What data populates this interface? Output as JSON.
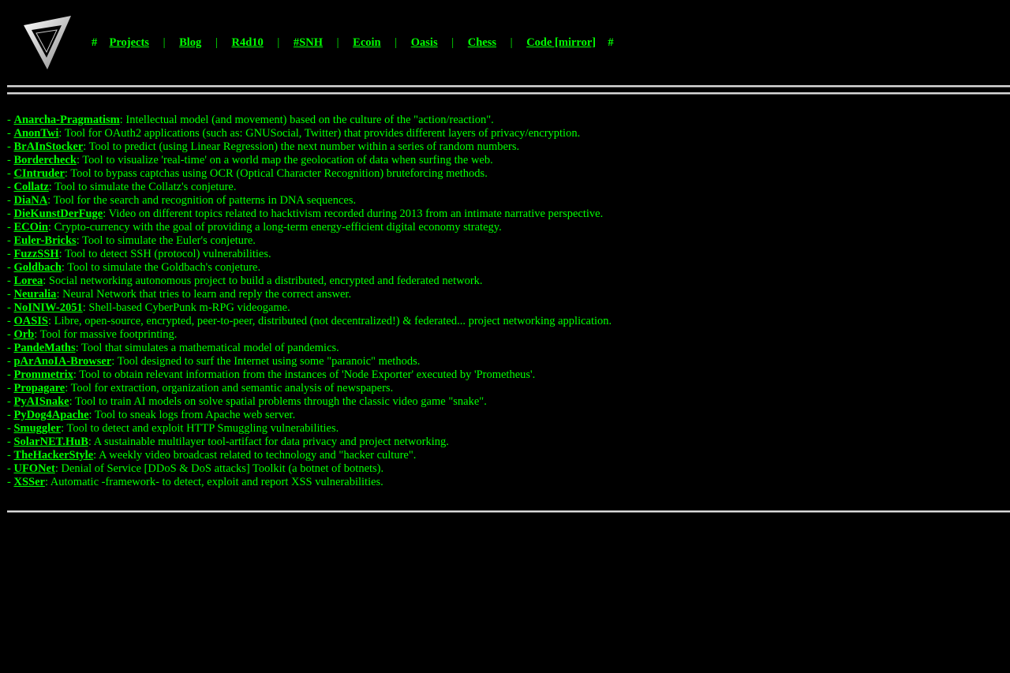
{
  "logo": {
    "icon": "triangle-logo-icon"
  },
  "nav": {
    "hash_left": "#",
    "hash_right": "#",
    "separator": "|",
    "items": [
      {
        "label": "Projects"
      },
      {
        "label": "Blog"
      },
      {
        "label": "R4d10"
      },
      {
        "label": "#SNH"
      },
      {
        "label": "Ecoin"
      },
      {
        "label": "Oasis"
      },
      {
        "label": "Chess"
      },
      {
        "label": "Code [mirror]"
      }
    ]
  },
  "projects": {
    "bullet": "- ",
    "items": [
      {
        "name": "Anarcha-Pragmatism",
        "desc": ": Intellectual model (and movement) based on the culture of the \"action/reaction\"."
      },
      {
        "name": "AnonTwi",
        "desc": ": Tool for OAuth2 applications (such as: GNUSocial, Twitter) that provides different layers of privacy/encryption."
      },
      {
        "name": "BrAInStocker",
        "desc": ": Tool to predict (using Linear Regression) the next number within a series of random numbers."
      },
      {
        "name": "Bordercheck",
        "desc": ": Tool to visualize 'real-time' on a world map the geolocation of data when surfing the web."
      },
      {
        "name": "CIntruder",
        "desc": ": Tool to bypass captchas using OCR (Optical Character Recognition) bruteforcing methods."
      },
      {
        "name": "Collatz",
        "desc": ": Tool to simulate the Collatz's conjeture."
      },
      {
        "name": "DiaNA",
        "desc": ": Tool for the search and recognition of patterns in DNA sequences."
      },
      {
        "name": "DieKunstDerFuge",
        "desc": ": Video on different topics related to hacktivism recorded during 2013 from an intimate narrative perspective."
      },
      {
        "name": "ECOin",
        "desc": ": Crypto-currency with the goal of providing a long-term energy-efficient digital economy strategy."
      },
      {
        "name": "Euler-Bricks",
        "desc": ": Tool to simulate the Euler's conjeture."
      },
      {
        "name": "FuzzSSH",
        "desc": ": Tool to detect SSH (protocol) vulnerabilities."
      },
      {
        "name": "Goldbach",
        "desc": ": Tool to simulate the Goldbach's conjeture."
      },
      {
        "name": "Lorea",
        "desc": ": Social networking autonomous project to build a distributed, encrypted and federated network."
      },
      {
        "name": "Neuralia",
        "desc": ": Neural Network that tries to learn and reply the correct answer."
      },
      {
        "name": "NoINIW-2051",
        "desc": ": Shell-based CyberPunk m-RPG videogame."
      },
      {
        "name": "OASIS",
        "desc": ": Libre, open-source, encrypted, peer-to-peer, distributed (not decentralized!) & federated... project networking application."
      },
      {
        "name": "Orb",
        "desc": ": Tool for massive footprinting."
      },
      {
        "name": "PandeMaths",
        "desc": ": Tool that simulates a mathematical model of pandemics."
      },
      {
        "name": "pArAnoIA-Browser",
        "desc": ": Tool designed to surf the Internet using some \"paranoic\" methods."
      },
      {
        "name": "Prommetrix",
        "desc": ": Tool to obtain relevant information from the instances of 'Node Exporter' executed by 'Prometheus'."
      },
      {
        "name": "Propagare",
        "desc": ": Tool for extraction, organization and semantic analysis of newspapers."
      },
      {
        "name": "PyAISnake",
        "desc": ": Tool to train AI models on solve spatial problems through the classic video game \"snake\"."
      },
      {
        "name": "PyDog4Apache",
        "desc": ": Tool to sneak logs from Apache web server."
      },
      {
        "name": "Smuggler",
        "desc": ": Tool to detect and exploit HTTP Smuggling vulnerabilities."
      },
      {
        "name": "SolarNET.HuB",
        "desc": ": A sustainable multilayer tool-artifact for data privacy and project networking."
      },
      {
        "name": "TheHackerStyle",
        "desc": ": A weekly video broadcast related to technology and \"hacker culture\"."
      },
      {
        "name": "UFONet",
        "desc": ": Denial of Service [DDoS & DoS attacks] Toolkit (a botnet of botnets)."
      },
      {
        "name": "XSSer",
        "desc": ": Automatic -framework- to detect, exploit and report XSS vulnerabilities."
      }
    ]
  },
  "colors": {
    "background": "#000000",
    "text": "#00ff00",
    "rule": "#d8d8d8"
  }
}
